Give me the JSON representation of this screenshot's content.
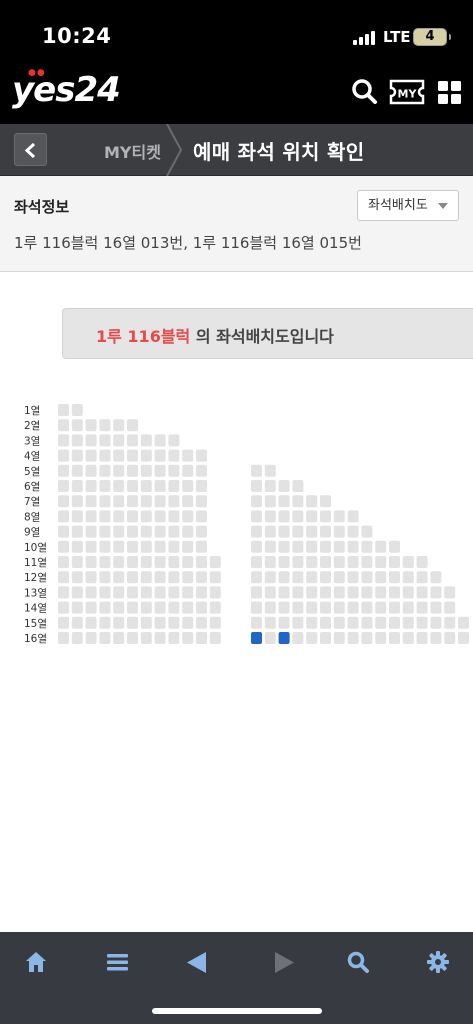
{
  "status": {
    "time": "10:24",
    "network": "LTE",
    "battery": "4"
  },
  "header": {
    "logo": "yes24",
    "my_label": "MY",
    "icons": [
      "search-icon",
      "my-ticket-icon",
      "menu-grid-icon"
    ]
  },
  "subnav": {
    "back_icon": "chevron-left-icon",
    "breadcrumb": "MY티켓",
    "title": "예매 좌석 위치 확인"
  },
  "seat_info": {
    "title": "좌석정보",
    "seats": "1루 116블럭 16열 013번, 1루 116블럭 16열 015번",
    "map_select": "좌석배치도"
  },
  "banner": {
    "highlight": "1루 116블럭",
    "text": " 의 좌석배치도입니다"
  },
  "seat_map": {
    "rows": [
      "1열",
      "2열",
      "3열",
      "4열",
      "5열",
      "6열",
      "7열",
      "8열",
      "9열",
      "10열",
      "11열",
      "12열",
      "13열",
      "14열",
      "15열",
      "16열"
    ],
    "left_counts": [
      2,
      6,
      9,
      11,
      11,
      11,
      11,
      11,
      11,
      11,
      12,
      12,
      12,
      12,
      12,
      12
    ],
    "right_counts": [
      0,
      0,
      0,
      0,
      2,
      4,
      6,
      8,
      9,
      11,
      13,
      14,
      15,
      15,
      16,
      16
    ],
    "selected": [
      {
        "row": 16,
        "section": "right",
        "seat": 1
      },
      {
        "row": 16,
        "section": "right",
        "seat": 3
      }
    ],
    "colors": {
      "seat": "#e2e2e2",
      "selected": "#1f66c7",
      "label": "#333333"
    }
  },
  "toolbar": {
    "icons": [
      "home-icon",
      "list-icon",
      "back-arrow-icon",
      "forward-arrow-icon",
      "search-icon",
      "settings-icon"
    ]
  }
}
